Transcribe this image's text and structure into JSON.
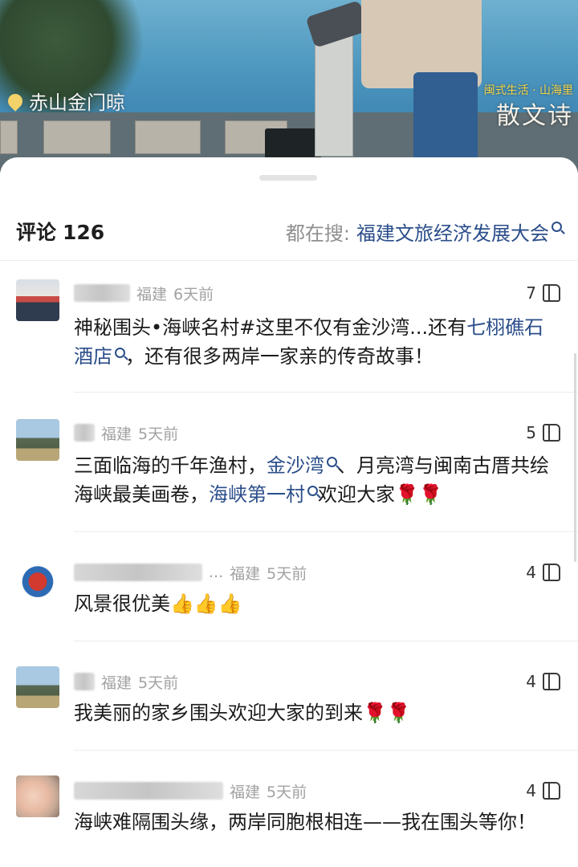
{
  "video": {
    "location": "赤山金门晾",
    "brand_line1": "闽式生活 · 山海里",
    "brand_title": "散文诗"
  },
  "header": {
    "comments_label": "评论",
    "comments_count": "126",
    "search_label": "都在搜:",
    "search_term": "福建文旅经济发展大会"
  },
  "comments": [
    {
      "region": "福建",
      "time": "6天前",
      "likes": "7",
      "segments": [
        "神秘围头•海峡名村#这里不仅有金沙湾...还有",
        "七栩礁石酒店",
        "，还有很多两岸一家亲的传奇故事！"
      ]
    },
    {
      "region": "福建",
      "time": "5天前",
      "likes": "5",
      "segments": [
        "三面临海的千年渔村，",
        "金沙湾",
        "、月亮湾与闽南古厝共绘海峡最美画卷，",
        "海峡第一村",
        "欢迎大家"
      ],
      "emoji": "🌹🌹"
    },
    {
      "name_suffix": "...",
      "region": "福建",
      "time": "5天前",
      "likes": "4",
      "segments": [
        "风景很优美"
      ],
      "emoji": "👍👍👍"
    },
    {
      "region": "福建",
      "time": "5天前",
      "likes": "4",
      "segments": [
        "我美丽的家乡围头欢迎大家的到来"
      ],
      "emoji": "🌹🌹"
    },
    {
      "region": "福建",
      "time": "5天前",
      "likes": "4",
      "segments": [
        "海峡难隔围头缘，两岸同胞根相连——我在围头等你！"
      ]
    }
  ]
}
